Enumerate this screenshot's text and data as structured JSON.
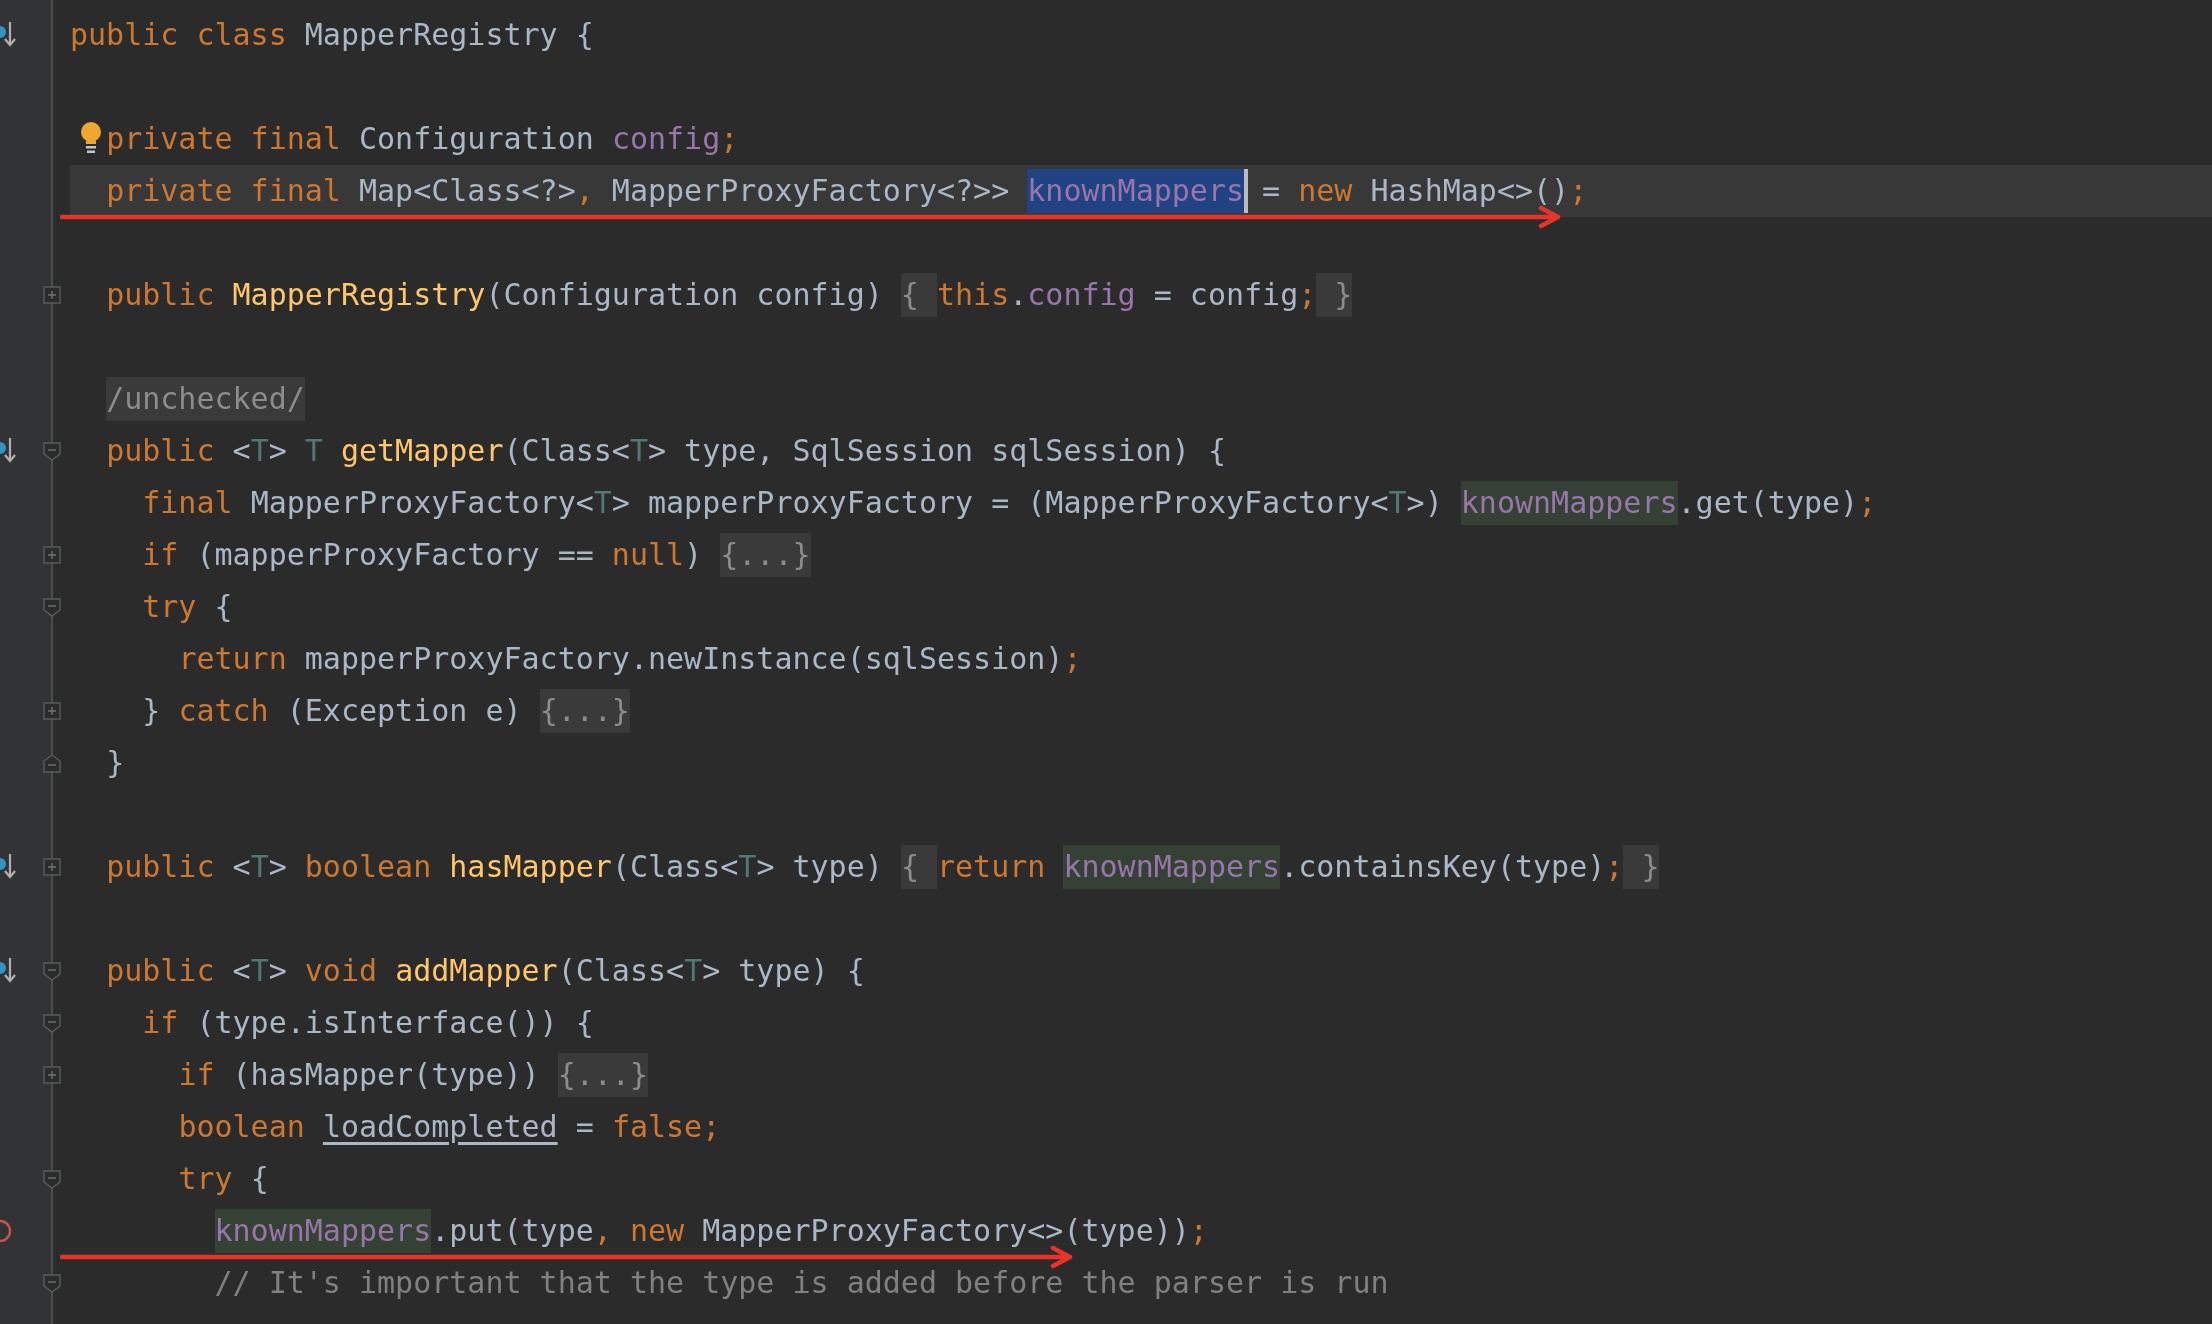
{
  "editor": {
    "lines": [
      {
        "kind": "code",
        "gutter_icon": {
          "kind": "implemented"
        },
        "tokens": [
          {
            "kind": "keyword",
            "text": "public class "
          },
          {
            "kind": "plain",
            "text": "MapperRegistry {"
          }
        ]
      },
      {
        "kind": "blank"
      },
      {
        "kind": "code",
        "bulb": true,
        "tokens": [
          {
            "kind": "keyword",
            "text": "  private final "
          },
          {
            "kind": "plain",
            "text": "Configuration "
          },
          {
            "kind": "field",
            "text": "config"
          },
          {
            "kind": "punct",
            "text": ";"
          }
        ]
      },
      {
        "kind": "code",
        "current": true,
        "arrow": true,
        "tokens": [
          {
            "kind": "keyword",
            "text": "  private final "
          },
          {
            "kind": "plain",
            "text": "Map<Class<?>"
          },
          {
            "kind": "punct",
            "text": ","
          },
          {
            "kind": "plain",
            "text": " MapperProxyFactory<?>> "
          },
          {
            "kind": "selected_field",
            "text": "knownMappers",
            "caret": true
          },
          {
            "kind": "plain",
            "text": " = "
          },
          {
            "kind": "keyword",
            "text": "new "
          },
          {
            "kind": "plain",
            "text": "HashMap<>()"
          },
          {
            "kind": "punct",
            "text": ";"
          }
        ]
      },
      {
        "kind": "blank"
      },
      {
        "kind": "code",
        "fold": {
          "kind": "expand"
        },
        "tokens": [
          {
            "kind": "keyword",
            "text": "  public "
          },
          {
            "kind": "method",
            "text": "MapperRegistry"
          },
          {
            "kind": "plain",
            "text": "(Configuration config) "
          },
          {
            "kind": "folded",
            "text": "{ "
          },
          {
            "kind": "keyword",
            "text": "this"
          },
          {
            "kind": "plain",
            "text": "."
          },
          {
            "kind": "field",
            "text": "config"
          },
          {
            "kind": "plain",
            "text": " = config"
          },
          {
            "kind": "punct",
            "text": ";"
          },
          {
            "kind": "folded",
            "text": " }"
          }
        ]
      },
      {
        "kind": "blank"
      },
      {
        "kind": "code",
        "tokens": [
          {
            "kind": "folded",
            "text": "  /unchecked/"
          }
        ]
      },
      {
        "kind": "code",
        "gutter_icon": {
          "kind": "implemented"
        },
        "fold": {
          "kind": "collapse_start"
        },
        "tokens": [
          {
            "kind": "keyword",
            "text": "  public "
          },
          {
            "kind": "plain",
            "text": "<"
          },
          {
            "kind": "type_param",
            "text": "T"
          },
          {
            "kind": "plain",
            "text": "> "
          },
          {
            "kind": "type_param",
            "text": "T "
          },
          {
            "kind": "method",
            "text": "getMapper"
          },
          {
            "kind": "plain",
            "text": "(Class<"
          },
          {
            "kind": "type_param",
            "text": "T"
          },
          {
            "kind": "plain",
            "text": "> type, SqlSession sqlSession) {"
          }
        ]
      },
      {
        "kind": "code",
        "tokens": [
          {
            "kind": "keyword",
            "text": "    final "
          },
          {
            "kind": "plain",
            "text": "MapperProxyFactory<"
          },
          {
            "kind": "type_param",
            "text": "T"
          },
          {
            "kind": "plain",
            "text": "> mapperProxyFactory = (MapperProxyFactory<"
          },
          {
            "kind": "type_param",
            "text": "T"
          },
          {
            "kind": "plain",
            "text": ">) "
          },
          {
            "kind": "field_usage",
            "text": "knownMappers"
          },
          {
            "kind": "plain",
            "text": ".get(type)"
          },
          {
            "kind": "punct",
            "text": ";"
          }
        ]
      },
      {
        "kind": "code",
        "fold": {
          "kind": "expand"
        },
        "tokens": [
          {
            "kind": "keyword",
            "text": "    if "
          },
          {
            "kind": "plain",
            "text": "(mapperProxyFactory == "
          },
          {
            "kind": "keyword",
            "text": "null"
          },
          {
            "kind": "plain",
            "text": ") "
          },
          {
            "kind": "folded",
            "text": "{...}"
          }
        ]
      },
      {
        "kind": "code",
        "fold": {
          "kind": "collapse_start"
        },
        "tokens": [
          {
            "kind": "keyword",
            "text": "    try "
          },
          {
            "kind": "plain",
            "text": "{"
          }
        ]
      },
      {
        "kind": "code",
        "tokens": [
          {
            "kind": "keyword",
            "text": "      return "
          },
          {
            "kind": "plain",
            "text": "mapperProxyFactory.newInstance(sqlSession)"
          },
          {
            "kind": "punct",
            "text": ";"
          }
        ]
      },
      {
        "kind": "code",
        "fold": {
          "kind": "expand"
        },
        "tokens": [
          {
            "kind": "plain",
            "text": "    } "
          },
          {
            "kind": "keyword",
            "text": "catch "
          },
          {
            "kind": "plain",
            "text": "(Exception e) "
          },
          {
            "kind": "folded",
            "text": "{...}"
          }
        ]
      },
      {
        "kind": "code",
        "fold": {
          "kind": "collapse_end"
        },
        "tokens": [
          {
            "kind": "plain",
            "text": "  }"
          }
        ]
      },
      {
        "kind": "blank"
      },
      {
        "kind": "code",
        "gutter_icon": {
          "kind": "implemented"
        },
        "fold": {
          "kind": "expand"
        },
        "tokens": [
          {
            "kind": "keyword",
            "text": "  public "
          },
          {
            "kind": "plain",
            "text": "<"
          },
          {
            "kind": "type_param",
            "text": "T"
          },
          {
            "kind": "plain",
            "text": "> "
          },
          {
            "kind": "keyword",
            "text": "boolean "
          },
          {
            "kind": "method",
            "text": "hasMapper"
          },
          {
            "kind": "plain",
            "text": "(Class<"
          },
          {
            "kind": "type_param",
            "text": "T"
          },
          {
            "kind": "plain",
            "text": "> type) "
          },
          {
            "kind": "folded",
            "text": "{ "
          },
          {
            "kind": "keyword",
            "text": "return "
          },
          {
            "kind": "field_usage",
            "text": "knownMappers"
          },
          {
            "kind": "plain",
            "text": ".containsKey(type)"
          },
          {
            "kind": "punct",
            "text": ";"
          },
          {
            "kind": "folded",
            "text": " }"
          }
        ]
      },
      {
        "kind": "blank"
      },
      {
        "kind": "code",
        "gutter_icon": {
          "kind": "implemented"
        },
        "fold": {
          "kind": "collapse_start"
        },
        "tokens": [
          {
            "kind": "keyword",
            "text": "  public "
          },
          {
            "kind": "plain",
            "text": "<"
          },
          {
            "kind": "type_param",
            "text": "T"
          },
          {
            "kind": "plain",
            "text": "> "
          },
          {
            "kind": "keyword",
            "text": "void "
          },
          {
            "kind": "method",
            "text": "addMapper"
          },
          {
            "kind": "plain",
            "text": "(Class<"
          },
          {
            "kind": "type_param",
            "text": "T"
          },
          {
            "kind": "plain",
            "text": "> type) {"
          }
        ]
      },
      {
        "kind": "code",
        "fold": {
          "kind": "collapse_start"
        },
        "tokens": [
          {
            "kind": "keyword",
            "text": "    if "
          },
          {
            "kind": "plain",
            "text": "(type.isInterface()) {"
          }
        ]
      },
      {
        "kind": "code",
        "fold": {
          "kind": "expand"
        },
        "tokens": [
          {
            "kind": "keyword",
            "text": "      if "
          },
          {
            "kind": "plain",
            "text": "(hasMapper(type)) "
          },
          {
            "kind": "folded",
            "text": "{...}"
          }
        ]
      },
      {
        "kind": "code",
        "tokens": [
          {
            "kind": "keyword",
            "text": "      boolean "
          },
          {
            "kind": "local_underlined",
            "text": "loadCompleted"
          },
          {
            "kind": "plain",
            "text": " = "
          },
          {
            "kind": "keyword",
            "text": "false"
          },
          {
            "kind": "punct",
            "text": ";"
          }
        ]
      },
      {
        "kind": "code",
        "fold": {
          "kind": "collapse_start"
        },
        "tokens": [
          {
            "kind": "keyword",
            "text": "      try "
          },
          {
            "kind": "plain",
            "text": "{"
          }
        ]
      },
      {
        "kind": "code",
        "gutter_icon": {
          "kind": "breakpoint"
        },
        "arrow": true,
        "tokens": [
          {
            "kind": "field_usage",
            "text": "        knownMappers"
          },
          {
            "kind": "plain",
            "text": ".put(type"
          },
          {
            "kind": "punct",
            "text": ", "
          },
          {
            "kind": "keyword",
            "text": "new "
          },
          {
            "kind": "plain",
            "text": "MapperProxyFactory<>(type))"
          },
          {
            "kind": "punct",
            "text": ";"
          }
        ]
      },
      {
        "kind": "code",
        "fold": {
          "kind": "collapse_start"
        },
        "tokens": [
          {
            "kind": "comment",
            "text": "        // It's important that the type is added before the parser is run"
          }
        ]
      }
    ]
  }
}
